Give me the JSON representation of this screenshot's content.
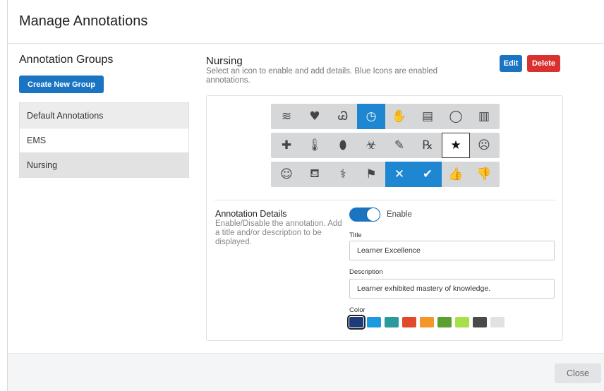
{
  "modal": {
    "title": "Manage Annotations"
  },
  "groups": {
    "title": "Annotation Groups",
    "create_label": "Create New Group",
    "items": [
      {
        "label": "Default Annotations",
        "selected": false
      },
      {
        "label": "EMS",
        "selected": false
      },
      {
        "label": "Nursing",
        "selected": true
      }
    ]
  },
  "group_detail": {
    "title": "Nursing",
    "subtitle": "Select an icon to enable and add details. Blue Icons are enabled annotations.",
    "edit_label": "Edit",
    "delete_label": "Delete"
  },
  "icon_rows": [
    [
      {
        "name": "breath-icon",
        "glyph": "≋",
        "state": "normal"
      },
      {
        "name": "heart-rate-icon",
        "glyph": "♥",
        "state": "normal"
      },
      {
        "name": "stethoscope-icon",
        "glyph": "Ꮚ",
        "state": "normal"
      },
      {
        "name": "scale-icon",
        "glyph": "◷",
        "state": "enabled"
      },
      {
        "name": "hand-icon",
        "glyph": "✋",
        "state": "normal"
      },
      {
        "name": "bandage-icon",
        "glyph": "▤",
        "state": "normal"
      },
      {
        "name": "speech-bubble-icon",
        "glyph": "◯",
        "state": "normal"
      },
      {
        "name": "barcode-icon",
        "glyph": "▥",
        "state": "normal"
      }
    ],
    [
      {
        "name": "clipboard-medical-icon",
        "glyph": "✚",
        "state": "normal"
      },
      {
        "name": "thermometer-icon",
        "glyph": "🌡",
        "state": "normal"
      },
      {
        "name": "pills-icon",
        "glyph": "⬮",
        "state": "normal"
      },
      {
        "name": "biohazard-icon",
        "glyph": "☣",
        "state": "normal"
      },
      {
        "name": "syringe-icon",
        "glyph": "✎",
        "state": "normal"
      },
      {
        "name": "prescription-icon",
        "glyph": "℞",
        "state": "normal"
      },
      {
        "name": "star-icon",
        "glyph": "★",
        "state": "selected"
      },
      {
        "name": "frown-face-icon",
        "glyph": "☹",
        "state": "normal"
      }
    ],
    [
      {
        "name": "smile-face-icon",
        "glyph": "☺",
        "state": "normal"
      },
      {
        "name": "hospital-bed-icon",
        "glyph": "⛾",
        "state": "normal"
      },
      {
        "name": "doctor-icon",
        "glyph": "⚕",
        "state": "normal"
      },
      {
        "name": "flag-icon",
        "glyph": "⚑",
        "state": "normal"
      },
      {
        "name": "x-mark-icon",
        "glyph": "✕",
        "state": "enabled"
      },
      {
        "name": "check-mark-icon",
        "glyph": "✔",
        "state": "enabled"
      },
      {
        "name": "thumbs-up-icon",
        "glyph": "👍",
        "state": "normal"
      },
      {
        "name": "thumbs-down-icon",
        "glyph": "👎",
        "state": "normal"
      }
    ]
  ],
  "details": {
    "title": "Annotation Details",
    "description": "Enable/Disable the annotation. Add a title and/or description to be displayed.",
    "enable_label": "Enable",
    "enabled": true,
    "title_label": "Title",
    "title_value": "Learner Excellence",
    "description_label": "Description",
    "description_value": "Learner exhibited mastery of knowledge.",
    "color_label": "Color",
    "colors": [
      "#1d3a7a",
      "#1a9be0",
      "#2a9a9a",
      "#e04a2a",
      "#f5952a",
      "#5aa030",
      "#a8e04a",
      "#4a4a4a",
      "#e2e2e2"
    ],
    "selected_color": "#1d3a7a"
  },
  "footer": {
    "close_label": "Close"
  }
}
